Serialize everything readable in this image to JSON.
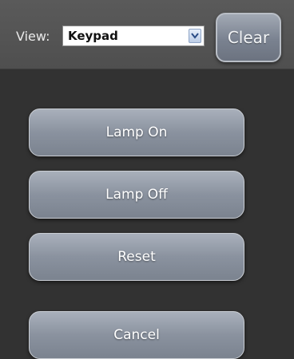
{
  "toolbar": {
    "view_label": "View:",
    "view_select": {
      "selected": "Keypad"
    },
    "clear_label": "Clear"
  },
  "buttons": [
    {
      "label": "Lamp On"
    },
    {
      "label": "Lamp Off"
    },
    {
      "label": "Reset"
    },
    {
      "label": "Cancel"
    }
  ]
}
